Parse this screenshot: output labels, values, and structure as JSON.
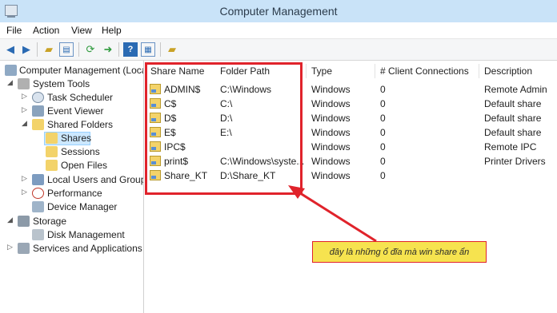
{
  "window": {
    "title": "Computer Management"
  },
  "menu": [
    "File",
    "Action",
    "View",
    "Help"
  ],
  "toolbar": {
    "buttons": [
      "back-icon",
      "forward-icon",
      "up-folder-icon",
      "show-hide-console-tree-icon",
      "refresh-icon",
      "export-list-icon",
      "help-icon",
      "properties-icon",
      "shared-folder-icon"
    ]
  },
  "tree": {
    "items": [
      {
        "label": "Computer Management (Local",
        "icon": "computer-management-icon"
      },
      {
        "label": "System Tools",
        "icon": "tools-icon"
      },
      {
        "label": "Task Scheduler",
        "icon": "clock-icon"
      },
      {
        "label": "Event Viewer",
        "icon": "event-viewer-icon"
      },
      {
        "label": "Shared Folders",
        "icon": "shared-folder-icon"
      },
      {
        "label": "Shares",
        "icon": "share-icon"
      },
      {
        "label": "Sessions",
        "icon": "share-icon"
      },
      {
        "label": "Open Files",
        "icon": "share-icon"
      },
      {
        "label": "Local Users and Groups",
        "icon": "users-icon"
      },
      {
        "label": "Performance",
        "icon": "performance-icon"
      },
      {
        "label": "Device Manager",
        "icon": "device-manager-icon"
      },
      {
        "label": "Storage",
        "icon": "storage-icon"
      },
      {
        "label": "Disk Management",
        "icon": "disk-icon"
      },
      {
        "label": "Services and Applications",
        "icon": "services-icon"
      }
    ]
  },
  "list": {
    "columns": [
      "Share Name",
      "Folder Path",
      "Type",
      "# Client Connections",
      "Description"
    ],
    "rows": [
      [
        "ADMIN$",
        "C:\\Windows",
        "Windows",
        "0",
        "Remote Admin"
      ],
      [
        "C$",
        "C:\\",
        "Windows",
        "0",
        "Default share"
      ],
      [
        "D$",
        "D:\\",
        "Windows",
        "0",
        "Default share"
      ],
      [
        "E$",
        "E:\\",
        "Windows",
        "0",
        "Default share"
      ],
      [
        "IPC$",
        "",
        "Windows",
        "0",
        "Remote IPC"
      ],
      [
        "print$",
        "C:\\Windows\\syste...",
        "Windows",
        "0",
        "Printer Drivers"
      ],
      [
        "Share_KT",
        "D:\\Share_KT",
        "Windows",
        "0",
        ""
      ]
    ]
  },
  "annotation": {
    "text": "đây là những ổ đĩa mà win share ẩn",
    "highlight_color": "#e0232b",
    "callout_color": "#f6e34f"
  }
}
